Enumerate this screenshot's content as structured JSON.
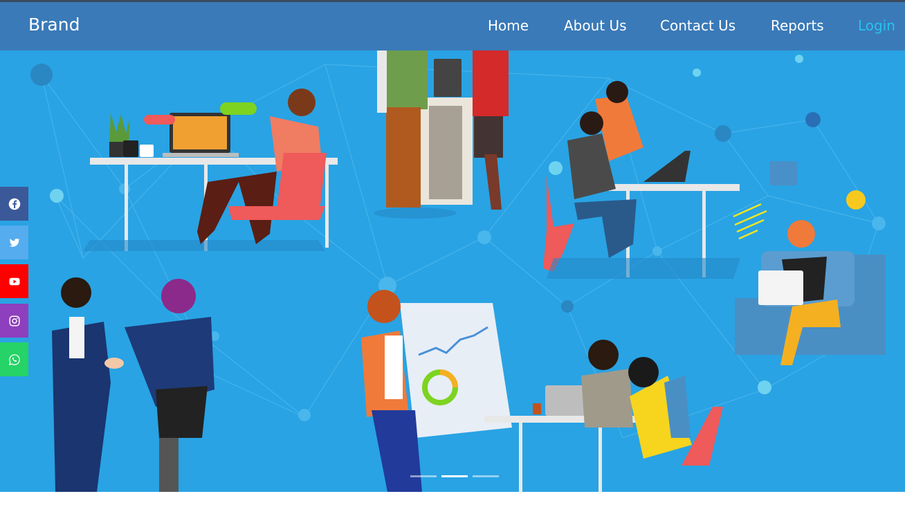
{
  "navbar": {
    "brand": "Brand",
    "links": [
      {
        "label": "Home",
        "active": false
      },
      {
        "label": "About Us",
        "active": false
      },
      {
        "label": "Contact Us",
        "active": false
      },
      {
        "label": "Reports",
        "active": false
      },
      {
        "label": "Login",
        "active": true
      }
    ]
  },
  "social": [
    {
      "icon": "facebook-icon",
      "color": "#3b5998"
    },
    {
      "icon": "twitter-icon",
      "color": "#55acee"
    },
    {
      "icon": "youtube-icon",
      "color": "#ff0000"
    },
    {
      "icon": "instagram-icon",
      "color": "#8e3fbe"
    },
    {
      "icon": "whatsapp-icon",
      "color": "#25d366"
    }
  ],
  "carousel": {
    "slide_count": 3,
    "active_index": 1
  },
  "colors": {
    "navbar": "#3a7ab8",
    "hero_bg": "#29a3e4",
    "active_link": "#29c1ee"
  }
}
